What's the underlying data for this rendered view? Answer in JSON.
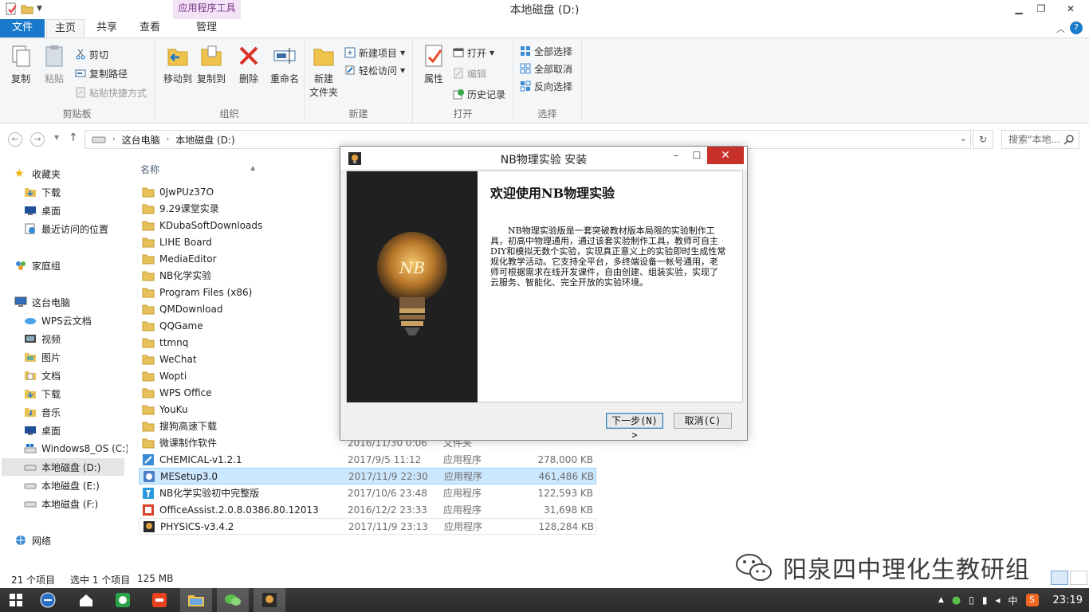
{
  "window": {
    "title": "本地磁盘 (D:)",
    "context_tab_header": "应用程序工具"
  },
  "tabs": {
    "file": "文件",
    "home": "主页",
    "share": "共享",
    "view": "查看",
    "manage": "管理"
  },
  "ribbon": {
    "clipboard": {
      "label": "剪贴板",
      "copy": "复制",
      "paste": "粘贴",
      "cut": "剪切",
      "copy_path": "复制路径",
      "paste_shortcut": "粘贴快捷方式"
    },
    "organize": {
      "label": "组织",
      "move_to": "移动到",
      "copy_to": "复制到",
      "delete": "删除",
      "rename": "重命名"
    },
    "new": {
      "label": "新建",
      "new_folder_line1": "新建",
      "new_folder_line2": "文件夹",
      "new_item": "新建项目",
      "easy_access": "轻松访问"
    },
    "open": {
      "label": "打开",
      "properties": "属性",
      "open": "打开",
      "edit": "编辑",
      "history": "历史记录"
    },
    "select": {
      "label": "选择",
      "select_all": "全部选择",
      "select_none": "全部取消",
      "invert": "反向选择"
    }
  },
  "address": {
    "crumb1": "这台电脑",
    "crumb2": "本地磁盘 (D:)",
    "search_placeholder": "搜索\"本地..."
  },
  "nav": {
    "favorites": "收藏夹",
    "downloads": "下载",
    "desktop": "桌面",
    "recent": "最近访问的位置",
    "homegroup": "家庭组",
    "this_pc": "这台电脑",
    "wps_cloud": "WPS云文档",
    "videos": "视频",
    "pictures": "图片",
    "documents": "文档",
    "downloads2": "下载",
    "music": "音乐",
    "desktop2": "桌面",
    "drive_c": "Windows8_OS (C:)",
    "drive_d": "本地磁盘 (D:)",
    "drive_e": "本地磁盘 (E:)",
    "drive_f": "本地磁盘 (F:)",
    "network": "网络"
  },
  "filelist": {
    "col_name": "名称",
    "folders": [
      "0JwPUz37O",
      "9.29课堂实录",
      "KDubaSoftDownloads",
      "LIHE Board",
      "MediaEditor",
      "NB化学实验",
      "Program Files (x86)",
      "QMDownload",
      "QQGame",
      "ttmnq",
      "WeChat",
      "Wopti",
      "WPS Office",
      "YouKu",
      "搜狗高速下载"
    ],
    "partial_row": {
      "name": "微课制作软件",
      "date": "2016/11/30 0:06",
      "type": "文件夹"
    },
    "files": [
      {
        "name": "CHEMICAL-v1.2.1",
        "date": "2017/9/5 11:12",
        "type": "应用程序",
        "size": "278,000 KB"
      },
      {
        "name": "MESetup3.0",
        "date": "2017/11/9 22:30",
        "type": "应用程序",
        "size": "461,486 KB"
      },
      {
        "name": "NB化学实验初中完整版",
        "date": "2017/10/6 23:48",
        "type": "应用程序",
        "size": "122,593 KB"
      },
      {
        "name": "OfficeAssist.2.0.8.0386.80.12013",
        "date": "2016/12/2 23:33",
        "type": "应用程序",
        "size": "31,698 KB"
      },
      {
        "name": "PHYSICS-v3.4.2",
        "date": "2017/11/9 23:13",
        "type": "应用程序",
        "size": "128,284 KB"
      }
    ]
  },
  "status": {
    "items": "21 个项目",
    "selected": "选中 1 个项目",
    "size": "125 MB"
  },
  "watermark": "阳泉四中理化生教研组",
  "dialog": {
    "title": "NB物理实验 安装",
    "heading": "欢迎使用NB物理实验",
    "body": "NB物理实验版是一套突破教材版本局限的实验制作工具，初高中物理通用，通过该套实验制作工具，教师可自主DIY和模拟无数个实验，实现真正意义上的实验即时生成性常规化教学活动。它支持全平台，多终端设备一帐号通用，老师可根据需求在线开发课件，自由创建、组装实验，实现了云服务、智能化、完全开放的实验环境。",
    "bulb_text": "NB",
    "next": "下一步(N) >",
    "cancel": "取消(C)"
  },
  "taskbar": {
    "ime": "中",
    "clock": "23:19"
  }
}
